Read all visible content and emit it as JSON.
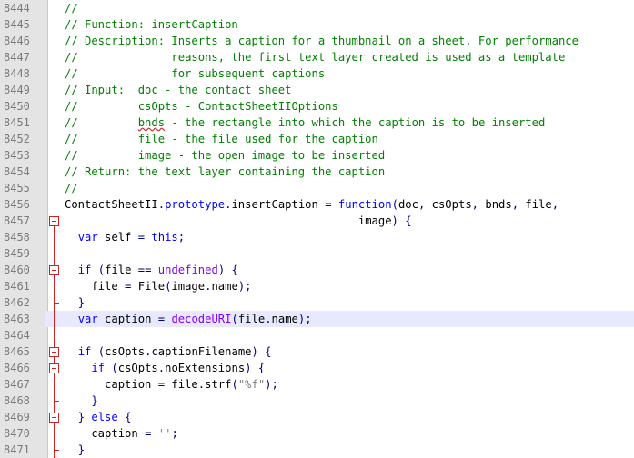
{
  "editor": {
    "colors": {
      "comment": "#008000",
      "keyword": "#0000ff",
      "purple": "#8000ff",
      "string": "#808080",
      "operator": "#000080",
      "fold_marker": "#cc2222",
      "active_line": "#e8e8ff",
      "gutter": "#e4e4e4"
    },
    "active_line": "8463",
    "lines": [
      {
        "n": "8444",
        "fold": "line",
        "tokens": [
          {
            "t": "//",
            "c": "comment"
          }
        ]
      },
      {
        "n": "8445",
        "fold": "line",
        "tokens": [
          {
            "t": "// Function: insertCaption",
            "c": "comment"
          }
        ]
      },
      {
        "n": "8446",
        "fold": "line",
        "tokens": [
          {
            "t": "// Description: Inserts a caption for a thumbnail on a sheet. For performance",
            "c": "comment"
          }
        ]
      },
      {
        "n": "8447",
        "fold": "line",
        "tokens": [
          {
            "t": "//              reasons, the first text layer created is used as a template",
            "c": "comment"
          }
        ]
      },
      {
        "n": "8448",
        "fold": "line",
        "tokens": [
          {
            "t": "//              for subsequent captions",
            "c": "comment"
          }
        ]
      },
      {
        "n": "8449",
        "fold": "line",
        "tokens": [
          {
            "t": "// Input:  doc - the contact sheet",
            "c": "comment"
          }
        ]
      },
      {
        "n": "8450",
        "fold": "line",
        "tokens": [
          {
            "t": "//         csOpts - ContactSheetIIOptions",
            "c": "comment"
          }
        ]
      },
      {
        "n": "8451",
        "fold": "line",
        "tokens": [
          {
            "t": "//         ",
            "c": "comment"
          },
          {
            "t": "bnds",
            "c": "comment",
            "squiggle": true
          },
          {
            "t": " - the rectangle into which the caption is to be inserted",
            "c": "comment"
          }
        ]
      },
      {
        "n": "8452",
        "fold": "line",
        "tokens": [
          {
            "t": "//         file - the file used for the caption",
            "c": "comment"
          }
        ]
      },
      {
        "n": "8453",
        "fold": "line",
        "tokens": [
          {
            "t": "//         image - the open image to be inserted",
            "c": "comment"
          }
        ]
      },
      {
        "n": "8454",
        "fold": "line",
        "tokens": [
          {
            "t": "// Return: the text layer containing the caption",
            "c": "comment"
          }
        ]
      },
      {
        "n": "8455",
        "fold": "line",
        "tokens": [
          {
            "t": "//",
            "c": "comment"
          }
        ]
      },
      {
        "n": "8456",
        "fold": "line",
        "tokens": [
          {
            "t": "ContactSheetII",
            "c": "plain"
          },
          {
            "t": ".",
            "c": "op"
          },
          {
            "t": "prototype",
            "c": "keyword"
          },
          {
            "t": ".",
            "c": "op"
          },
          {
            "t": "insertCaption ",
            "c": "plain"
          },
          {
            "t": "=",
            "c": "op"
          },
          {
            "t": " ",
            "c": "plain"
          },
          {
            "t": "function",
            "c": "keyword"
          },
          {
            "t": "(",
            "c": "op"
          },
          {
            "t": "doc",
            "c": "plain"
          },
          {
            "t": ",",
            "c": "op"
          },
          {
            "t": " csOpts",
            "c": "plain"
          },
          {
            "t": ",",
            "c": "op"
          },
          {
            "t": " bnds",
            "c": "plain"
          },
          {
            "t": ",",
            "c": "op"
          },
          {
            "t": " file",
            "c": "plain"
          },
          {
            "t": ",",
            "c": "op"
          }
        ]
      },
      {
        "n": "8457",
        "fold": "box",
        "tokens": [
          {
            "t": "                                            ",
            "c": "plain"
          },
          {
            "t": "image",
            "c": "plain"
          },
          {
            "t": ")",
            "c": "op"
          },
          {
            "t": " {",
            "c": "op"
          }
        ]
      },
      {
        "n": "8458",
        "fold": "line",
        "tokens": [
          {
            "t": "  ",
            "c": "plain"
          },
          {
            "t": "var",
            "c": "keyword"
          },
          {
            "t": " self ",
            "c": "plain"
          },
          {
            "t": "=",
            "c": "op"
          },
          {
            "t": " ",
            "c": "plain"
          },
          {
            "t": "this",
            "c": "keyword"
          },
          {
            "t": ";",
            "c": "op"
          }
        ]
      },
      {
        "n": "8459",
        "fold": "line",
        "tokens": []
      },
      {
        "n": "8460",
        "fold": "box",
        "tokens": [
          {
            "t": "  ",
            "c": "plain"
          },
          {
            "t": "if",
            "c": "keyword"
          },
          {
            "t": " ",
            "c": "plain"
          },
          {
            "t": "(",
            "c": "op"
          },
          {
            "t": "file ",
            "c": "plain"
          },
          {
            "t": "==",
            "c": "op"
          },
          {
            "t": " ",
            "c": "plain"
          },
          {
            "t": "undefined",
            "c": "purple"
          },
          {
            "t": ")",
            "c": "op"
          },
          {
            "t": " {",
            "c": "op"
          }
        ]
      },
      {
        "n": "8461",
        "fold": "line",
        "tokens": [
          {
            "t": "    file ",
            "c": "plain"
          },
          {
            "t": "=",
            "c": "op"
          },
          {
            "t": " File",
            "c": "plain"
          },
          {
            "t": "(",
            "c": "op"
          },
          {
            "t": "image",
            "c": "plain"
          },
          {
            "t": ".",
            "c": "op"
          },
          {
            "t": "name",
            "c": "plain"
          },
          {
            "t": ");",
            "c": "op"
          }
        ]
      },
      {
        "n": "8462",
        "fold": "tick",
        "tokens": [
          {
            "t": "  ",
            "c": "plain"
          },
          {
            "t": "}",
            "c": "op"
          }
        ]
      },
      {
        "n": "8463",
        "fold": "line",
        "tokens": [
          {
            "t": "  ",
            "c": "plain"
          },
          {
            "t": "var",
            "c": "keyword"
          },
          {
            "t": " caption ",
            "c": "plain"
          },
          {
            "t": "=",
            "c": "op"
          },
          {
            "t": " ",
            "c": "plain"
          },
          {
            "t": "decodeURI",
            "c": "purple"
          },
          {
            "t": "(",
            "c": "op"
          },
          {
            "t": "file",
            "c": "plain"
          },
          {
            "t": ".",
            "c": "op"
          },
          {
            "t": "name",
            "c": "plain"
          },
          {
            "t": ");",
            "c": "op"
          }
        ]
      },
      {
        "n": "8464",
        "fold": "line",
        "tokens": []
      },
      {
        "n": "8465",
        "fold": "box",
        "tokens": [
          {
            "t": "  ",
            "c": "plain"
          },
          {
            "t": "if",
            "c": "keyword"
          },
          {
            "t": " ",
            "c": "plain"
          },
          {
            "t": "(",
            "c": "op"
          },
          {
            "t": "csOpts",
            "c": "plain"
          },
          {
            "t": ".",
            "c": "op"
          },
          {
            "t": "captionFilename",
            "c": "plain"
          },
          {
            "t": ")",
            "c": "op"
          },
          {
            "t": " {",
            "c": "op"
          }
        ]
      },
      {
        "n": "8466",
        "fold": "box",
        "tokens": [
          {
            "t": "    ",
            "c": "plain"
          },
          {
            "t": "if",
            "c": "keyword"
          },
          {
            "t": " ",
            "c": "plain"
          },
          {
            "t": "(",
            "c": "op"
          },
          {
            "t": "csOpts",
            "c": "plain"
          },
          {
            "t": ".",
            "c": "op"
          },
          {
            "t": "noExtensions",
            "c": "plain"
          },
          {
            "t": ")",
            "c": "op"
          },
          {
            "t": " {",
            "c": "op"
          }
        ]
      },
      {
        "n": "8467",
        "fold": "line",
        "tokens": [
          {
            "t": "      caption ",
            "c": "plain"
          },
          {
            "t": "=",
            "c": "op"
          },
          {
            "t": " file",
            "c": "plain"
          },
          {
            "t": ".",
            "c": "op"
          },
          {
            "t": "strf",
            "c": "plain"
          },
          {
            "t": "(",
            "c": "op"
          },
          {
            "t": "\"%f\"",
            "c": "string"
          },
          {
            "t": ");",
            "c": "op"
          }
        ]
      },
      {
        "n": "8468",
        "fold": "tick",
        "tokens": [
          {
            "t": "    ",
            "c": "plain"
          },
          {
            "t": "}",
            "c": "op"
          }
        ]
      },
      {
        "n": "8469",
        "fold": "box",
        "tokens": [
          {
            "t": "  ",
            "c": "plain"
          },
          {
            "t": "}",
            "c": "op"
          },
          {
            "t": " ",
            "c": "plain"
          },
          {
            "t": "else",
            "c": "keyword"
          },
          {
            "t": " {",
            "c": "op"
          }
        ]
      },
      {
        "n": "8470",
        "fold": "line",
        "tokens": [
          {
            "t": "    caption ",
            "c": "plain"
          },
          {
            "t": "=",
            "c": "op"
          },
          {
            "t": " ",
            "c": "plain"
          },
          {
            "t": "''",
            "c": "string"
          },
          {
            "t": ";",
            "c": "op"
          }
        ]
      },
      {
        "n": "8471",
        "fold": "tick",
        "tokens": [
          {
            "t": "  ",
            "c": "plain"
          },
          {
            "t": "}",
            "c": "op"
          }
        ]
      }
    ]
  }
}
